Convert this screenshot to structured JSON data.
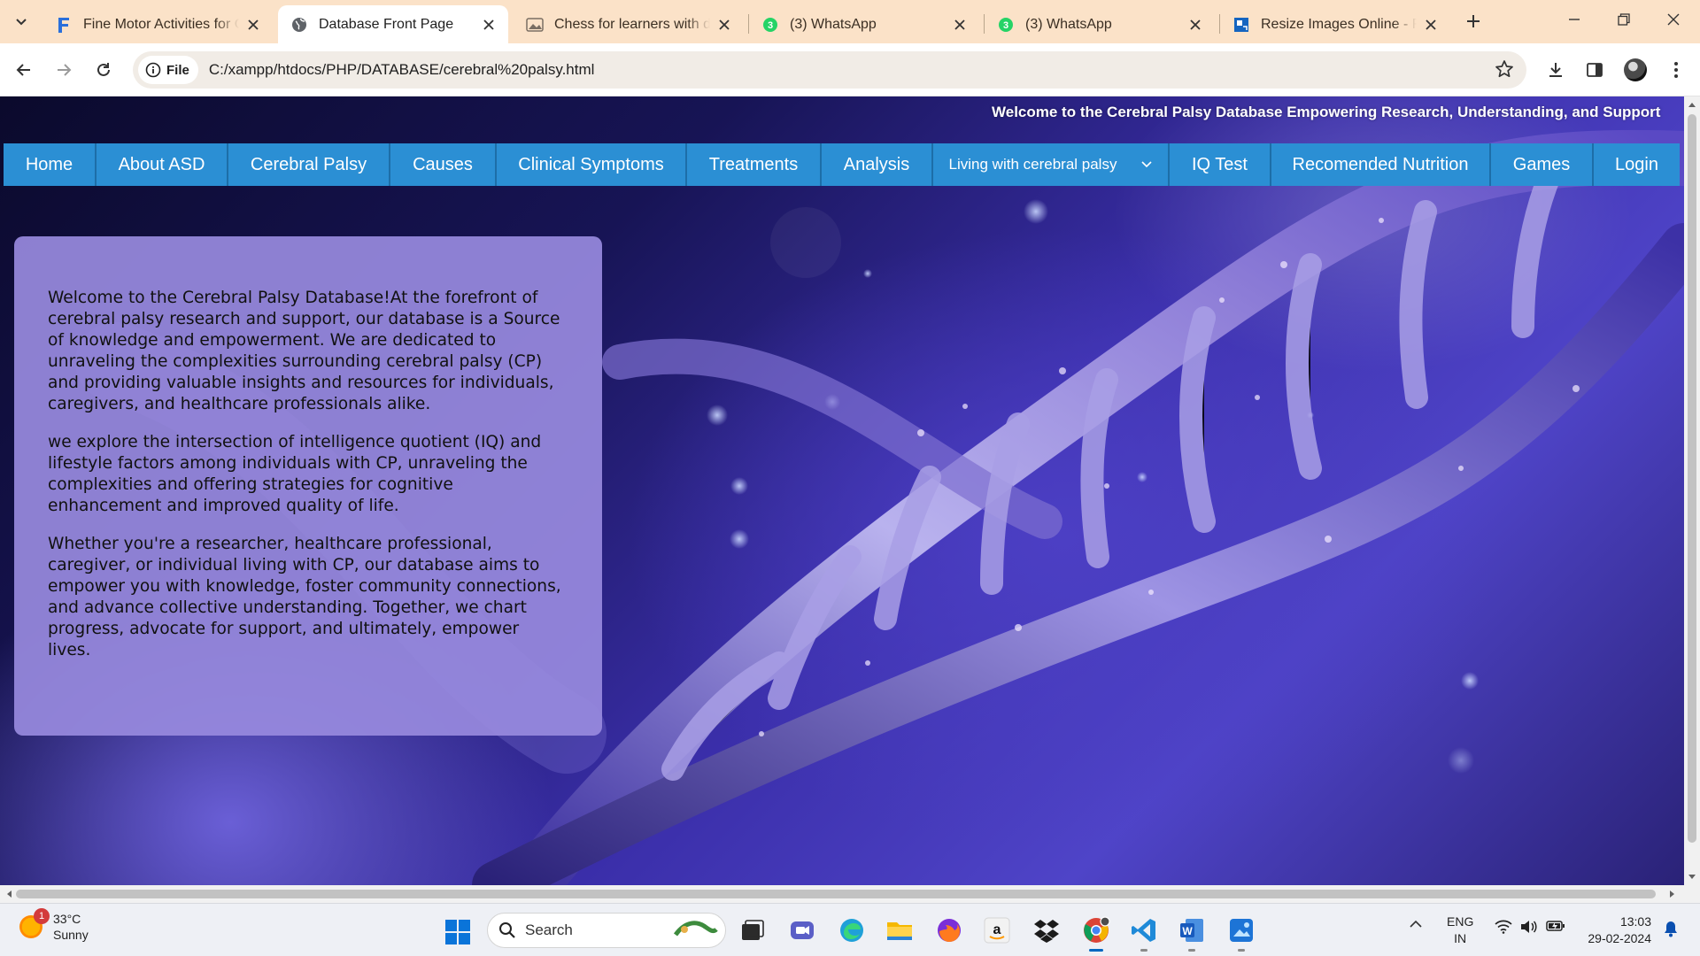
{
  "browser": {
    "tabs": [
      {
        "title": "Fine Motor Activities for Children",
        "favicon": "f-logo-icon"
      },
      {
        "title": "Database Front Page",
        "favicon": "globe-icon",
        "active": true
      },
      {
        "title": "Chess for learners with disabilities",
        "favicon": "image-icon"
      },
      {
        "title": "(3) WhatsApp",
        "favicon": "whatsapp-icon"
      },
      {
        "title": "(3) WhatsApp",
        "favicon": "whatsapp-icon"
      },
      {
        "title": "Resize Images Online - Resize",
        "favicon": "resize-icon"
      }
    ],
    "chip_label": "File",
    "url": "C:/xampp/htdocs/PHP/DATABASE/cerebral%20palsy.html"
  },
  "page": {
    "marquee": "Welcome to the Cerebral Palsy Database Empowering Research, Understanding, and Support",
    "menu": [
      "Home",
      "About ASD",
      "Cerebral Palsy",
      "Causes",
      "Clinical Symptoms",
      "Treatments",
      "Analysis",
      "Living with cerebral palsy",
      "IQ Test",
      "Recomended Nutrition",
      "Games",
      "Login"
    ],
    "paragraphs": [
      "Welcome to the Cerebral Palsy Database!At the forefront of cerebral palsy research and support, our database is a Source of knowledge and empowerment. We are dedicated to unraveling the complexities surrounding cerebral palsy (CP) and providing valuable insights and resources for individuals, caregivers, and healthcare professionals alike.",
      "we explore the intersection of intelligence quotient (IQ) and lifestyle factors among individuals with CP, unraveling the complexities and offering strategies for cognitive enhancement and improved quality of life.",
      "Whether you're a researcher, healthcare professional, caregiver, or individual living with CP, our database aims to empower you with knowledge, foster community connections, and advance collective understanding. Together, we chart progress, advocate for support, and ultimately, empower lives."
    ]
  },
  "taskbar": {
    "weather_temp": "33°C",
    "weather_desc": "Sunny",
    "weather_badge": "1",
    "search_label": "Search",
    "lang_line1": "ENG",
    "lang_line2": "IN",
    "time": "13:03",
    "date": "29-02-2024"
  },
  "colors": {
    "tabbar": "#fbe2c8",
    "menu": "#2b8fd4",
    "info_box": "#988ade"
  }
}
